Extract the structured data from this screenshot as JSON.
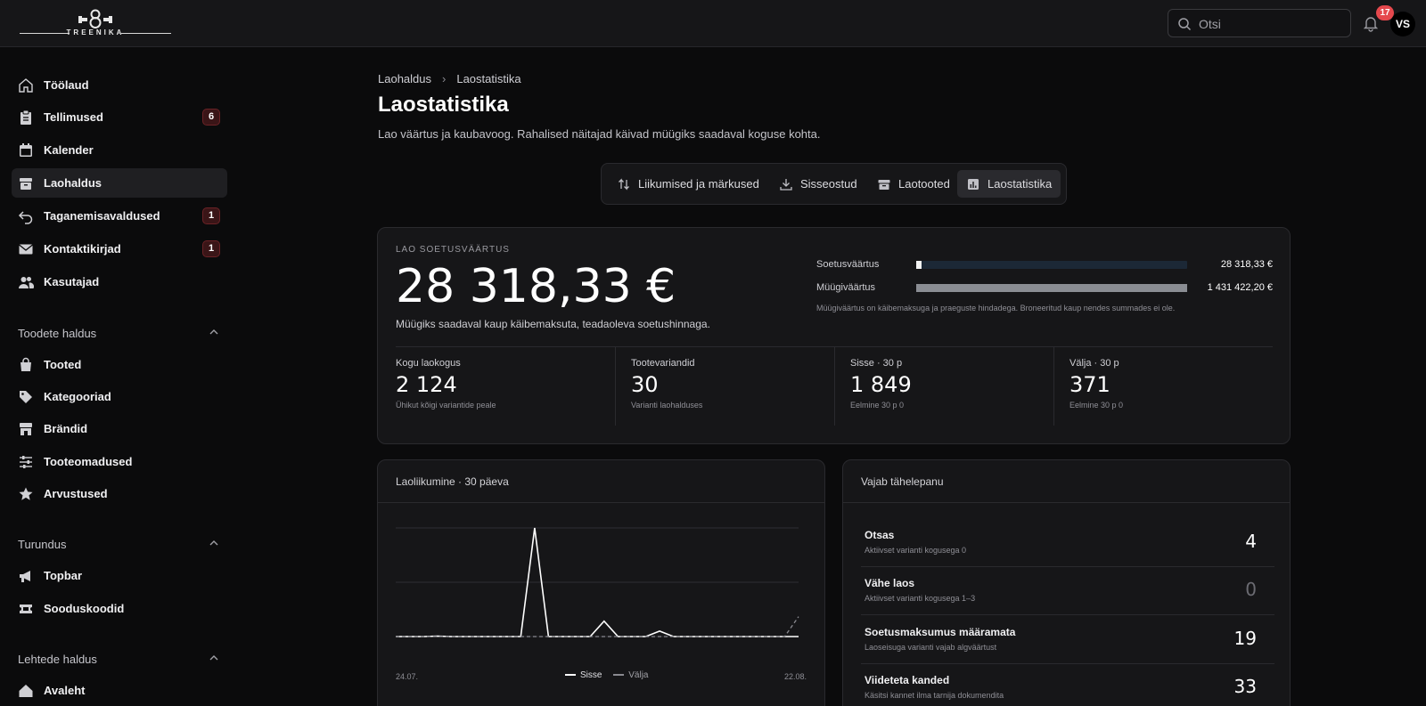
{
  "brand": {
    "wordmark": "TREENIKA"
  },
  "search": {
    "placeholder": "Otsi"
  },
  "notifications": {
    "count": "17"
  },
  "user": {
    "initials": "VS"
  },
  "sidebar": {
    "main": [
      {
        "label": "Töölaud",
        "icon": "home-icon"
      },
      {
        "label": "Tellimused",
        "icon": "clipboard-icon",
        "badge": "6"
      },
      {
        "label": "Kalender",
        "icon": "calendar-icon"
      },
      {
        "label": "Laohaldus",
        "icon": "archive-icon",
        "active": true
      },
      {
        "label": "Taganemisavaldused",
        "icon": "undo-icon",
        "badge": "1"
      },
      {
        "label": "Kontaktikirjad",
        "icon": "mail-icon",
        "badge": "1"
      },
      {
        "label": "Kasutajad",
        "icon": "users-icon"
      }
    ],
    "sections": [
      {
        "title": "Toodete haldus",
        "items": [
          {
            "label": "Tooted",
            "icon": "shopping-bag-icon"
          },
          {
            "label": "Kategooriad",
            "icon": "tag-icon"
          },
          {
            "label": "Brändid",
            "icon": "store-icon"
          },
          {
            "label": "Tooteomadused",
            "icon": "sliders-icon"
          },
          {
            "label": "Arvustused",
            "icon": "star-icon"
          }
        ]
      },
      {
        "title": "Turundus",
        "items": [
          {
            "label": "Topbar",
            "icon": "megaphone-icon"
          },
          {
            "label": "Sooduskoodid",
            "icon": "ticket-icon"
          }
        ]
      },
      {
        "title": "Lehtede haldus",
        "items": [
          {
            "label": "Avaleht",
            "icon": "home-alt-icon"
          }
        ]
      }
    ]
  },
  "breadcrumb": {
    "parent": "Laohaldus",
    "current": "Laostatistika"
  },
  "page": {
    "title": "Laostatistika",
    "description": "Lao väärtus ja kaubavoog. Rahalised näitajad käivad müügiks saadaval koguse kohta."
  },
  "tabs": [
    {
      "label": "Liikumised ja märkused",
      "icon": "arrows-updown-icon"
    },
    {
      "label": "Sisseostud",
      "icon": "download-icon"
    },
    {
      "label": "Laotooted",
      "icon": "archive-icon"
    },
    {
      "label": "Laostatistika",
      "icon": "bar-chart-icon",
      "active": true
    }
  ],
  "summary": {
    "label": "LAO SOETUSVÄÄRTUS",
    "value": "28 318,33 €",
    "subtitle": "Müügiks saadaval kaup käibemaksuta, teadaoleva soetushinnaga.",
    "bars": [
      {
        "label": "Soetusväärtus",
        "value": "28 318,33 €",
        "fraction": 0.0198
      },
      {
        "label": "Müügiväärtus",
        "value": "1 431 422,20 €",
        "fraction": 1.0
      }
    ],
    "note": "Müügiväärtus on käibemaksuga ja praeguste hindadega. Broneeritud kaup nendes summades ei ole.",
    "stats": [
      {
        "title": "Kogu laokogus",
        "value": "2 124",
        "sub": "Ühikut kõigi variantide peale"
      },
      {
        "title": "Tootevariandid",
        "value": "30",
        "sub": "Varianti laohalduses"
      },
      {
        "title": "Sisse · 30 p",
        "value": "1 849",
        "sub": "Eelmine 30 p 0"
      },
      {
        "title": "Välja · 30 p",
        "value": "371",
        "sub": "Eelmine 30 p 0"
      }
    ]
  },
  "movement": {
    "title": "Laoliikumine · 30 päeva",
    "start_label": "24.07.",
    "end_label": "22.08.",
    "legend_in": "Sisse",
    "legend_out": "Välja"
  },
  "chart_data": {
    "type": "line",
    "x_start": "24.07.",
    "x_end": "22.08.",
    "grid": true,
    "legend": "bottom-center",
    "series": [
      {
        "name": "Sisse",
        "values": [
          0,
          0,
          0,
          5,
          0,
          0,
          0,
          0,
          0,
          0,
          1200,
          0,
          0,
          0,
          0,
          170,
          0,
          0,
          0,
          60,
          0,
          0,
          0,
          0,
          0,
          0,
          0,
          0,
          0,
          0
        ]
      },
      {
        "name": "Välja",
        "values": [
          0,
          0,
          0,
          0,
          0,
          0,
          0,
          0,
          0,
          0,
          0,
          0,
          0,
          0,
          0,
          0,
          0,
          0,
          0,
          0,
          0,
          0,
          0,
          0,
          0,
          0,
          0,
          0,
          0,
          220
        ]
      }
    ],
    "ylim": [
      0,
      1200
    ]
  },
  "attention": {
    "title": "Vajab tähelepanu",
    "rows": [
      {
        "title": "Otsas",
        "sub": "Aktiivset varianti kogusega 0",
        "value": "4"
      },
      {
        "title": "Vähe laos",
        "sub": "Aktiivset varianti kogusega 1–3",
        "value": "0",
        "muted": true
      },
      {
        "title": "Soetusmaksumus määramata",
        "sub": "Laoseisuga varianti vajab algväärtust",
        "value": "19"
      },
      {
        "title": "Viideteta kanded",
        "sub": "Käsitsi kannet ilma tarnija dokumendita",
        "value": "33"
      }
    ]
  }
}
